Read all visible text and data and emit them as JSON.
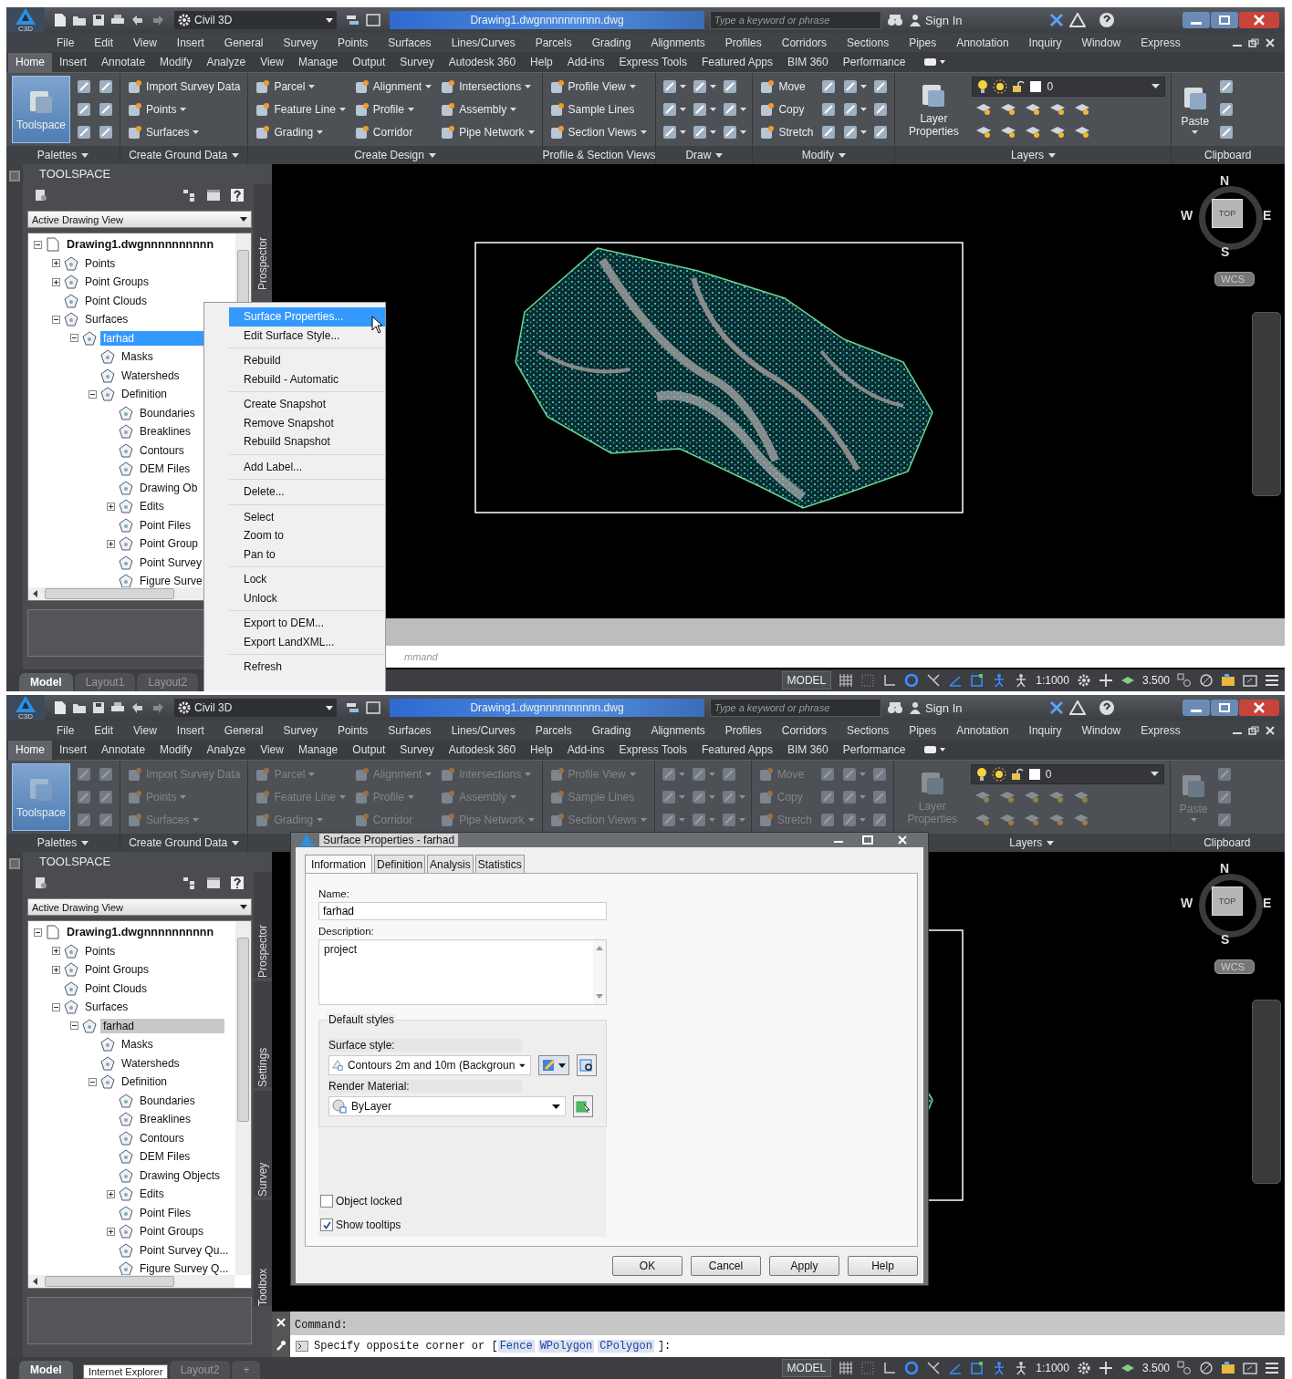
{
  "screens": [
    {
      "title_bar": {
        "app_badge": "C3D",
        "workspace": "Civil 3D",
        "document": "Drawing1.dwgnnnnnnnnnn.dwg",
        "placeholder": "Type a keyword or phrase",
        "sign_in": "Sign In"
      },
      "menu": [
        "File",
        "Edit",
        "View",
        "Insert",
        "General",
        "Survey",
        "Points",
        "Surfaces",
        "Lines/Curves",
        "Parcels",
        "Grading",
        "Alignments",
        "Profiles",
        "Corridors",
        "Sections",
        "Pipes",
        "Annotation",
        "Inquiry",
        "Window",
        "Express"
      ],
      "ribbon_tabs": [
        {
          "label": "Home",
          "selected": true
        },
        {
          "label": "Insert",
          "selected": false
        },
        {
          "label": "Annotate",
          "selected": false
        },
        {
          "label": "Modify",
          "selected": false
        },
        {
          "label": "Analyze",
          "selected": false
        },
        {
          "label": "View",
          "selected": false
        },
        {
          "label": "Manage",
          "selected": false
        },
        {
          "label": "Output",
          "selected": false
        },
        {
          "label": "Survey",
          "selected": false
        },
        {
          "label": "Autodesk 360",
          "selected": false
        },
        {
          "label": "Help",
          "selected": false
        },
        {
          "label": "Add-ins",
          "selected": false
        },
        {
          "label": "Express Tools",
          "selected": false
        },
        {
          "label": "Featured Apps",
          "selected": false
        },
        {
          "label": "BIM 360",
          "selected": false
        },
        {
          "label": "Performance",
          "selected": false
        }
      ],
      "ribbon": {
        "disabled": false,
        "panels": [
          {
            "title": "Palettes",
            "menu": true,
            "columns": [
              [
                {
                  "kind": "large",
                  "label": "Toolspace",
                  "on": true,
                  "menu": false
                }
              ],
              [
                {
                  "kind": "icon",
                  "menu": false
                },
                {
                  "kind": "icon",
                  "menu": false
                },
                {
                  "kind": "icon",
                  "menu": false
                }
              ],
              [
                {
                  "kind": "icon",
                  "menu": false
                },
                {
                  "kind": "icon",
                  "menu": false
                },
                {
                  "kind": "icon",
                  "menu": false
                }
              ]
            ]
          },
          {
            "title": "Create Ground Data",
            "menu": true,
            "columns": [
              [
                {
                  "kind": "small",
                  "label": "Import Survey Data",
                  "menu": false
                },
                {
                  "kind": "small",
                  "label": "Points",
                  "menu": true
                },
                {
                  "kind": "small",
                  "label": "Surfaces",
                  "menu": true
                }
              ]
            ]
          },
          {
            "title": "Create Design",
            "menu": true,
            "columns": [
              [
                {
                  "kind": "small",
                  "label": "Parcel",
                  "menu": true
                },
                {
                  "kind": "small",
                  "label": "Feature Line",
                  "menu": true
                },
                {
                  "kind": "small",
                  "label": "Grading",
                  "menu": true
                }
              ],
              [
                {
                  "kind": "small",
                  "label": "Alignment",
                  "menu": true
                },
                {
                  "kind": "small",
                  "label": "Profile",
                  "menu": true
                },
                {
                  "kind": "small",
                  "label": "Corridor",
                  "menu": false
                }
              ],
              [
                {
                  "kind": "small",
                  "label": "Intersections",
                  "menu": true
                },
                {
                  "kind": "small",
                  "label": "Assembly",
                  "menu": true
                },
                {
                  "kind": "small",
                  "label": "Pipe Network",
                  "menu": true
                }
              ]
            ]
          },
          {
            "title": "Profile & Section Views",
            "menu": false,
            "columns": [
              [
                {
                  "kind": "small",
                  "label": "Profile View",
                  "menu": true
                },
                {
                  "kind": "small",
                  "label": "Sample Lines",
                  "menu": false
                },
                {
                  "kind": "small",
                  "label": "Section Views",
                  "menu": true
                }
              ]
            ]
          },
          {
            "title": "Draw",
            "menu": true,
            "columns": [
              [
                {
                  "kind": "icon",
                  "menu": true
                },
                {
                  "kind": "icon",
                  "menu": true
                },
                {
                  "kind": "icon",
                  "menu": true
                }
              ],
              [
                {
                  "kind": "icon",
                  "menu": true
                },
                {
                  "kind": "icon",
                  "menu": true
                },
                {
                  "kind": "icon",
                  "menu": true
                }
              ],
              [
                {
                  "kind": "icon",
                  "menu": false
                },
                {
                  "kind": "icon",
                  "menu": true
                },
                {
                  "kind": "icon",
                  "menu": true
                }
              ]
            ]
          },
          {
            "title": "Modify",
            "menu": true,
            "columns": [
              [
                {
                  "kind": "small",
                  "label": "Move",
                  "menu": false
                },
                {
                  "kind": "small",
                  "label": "Copy",
                  "menu": false
                },
                {
                  "kind": "small",
                  "label": "Stretch",
                  "menu": false
                }
              ],
              [
                {
                  "kind": "icon",
                  "menu": false
                },
                {
                  "kind": "icon",
                  "menu": false
                },
                {
                  "kind": "icon",
                  "menu": false
                }
              ],
              [
                {
                  "kind": "icon",
                  "menu": true
                },
                {
                  "kind": "icon",
                  "menu": true
                },
                {
                  "kind": "icon",
                  "menu": true
                }
              ],
              [
                {
                  "kind": "icon",
                  "menu": false
                },
                {
                  "kind": "icon",
                  "menu": false
                },
                {
                  "kind": "icon",
                  "menu": false
                }
              ]
            ]
          },
          {
            "title": "Layers",
            "menu": true,
            "columns": [
              [
                {
                  "kind": "large",
                  "label": "Layer Properties",
                  "on": false,
                  "menu": false
                }
              ],
              [
                {
                  "kind": "combo",
                  "label": "0",
                  "menu": true
                },
                {
                  "kind": "strip",
                  "menu": false
                },
                {
                  "kind": "strip",
                  "menu": false
                }
              ]
            ]
          },
          {
            "title": "Clipboard",
            "menu": false,
            "columns": [
              [
                {
                  "kind": "large",
                  "label": "Paste",
                  "on": false,
                  "menu": true
                }
              ],
              [
                {
                  "kind": "icon",
                  "menu": false
                },
                {
                  "kind": "icon",
                  "menu": false
                },
                {
                  "kind": "icon",
                  "menu": false
                }
              ]
            ]
          }
        ]
      },
      "toolspace": {
        "title": "TOOLSPACE",
        "view": "Active Drawing View",
        "tree_focused": true,
        "side_tabs": [
          "Prospector"
        ],
        "tree": {
          "label": "Drawing1.dwgnnnnnnnnnn",
          "expanded": true,
          "selected": false,
          "children": [
            {
              "label": "Points",
              "expanded": false,
              "selected": false
            },
            {
              "label": "Point Groups",
              "expanded": false,
              "selected": false
            },
            {
              "label": "Point Clouds",
              "selected": false
            },
            {
              "label": "Surfaces",
              "expanded": true,
              "selected": false,
              "children": [
                {
                  "label": "farhad",
                  "expanded": true,
                  "selected": true,
                  "children": [
                    {
                      "label": "Masks",
                      "selected": false
                    },
                    {
                      "label": "Watersheds",
                      "selected": false
                    },
                    {
                      "label": "Definition",
                      "expanded": true,
                      "selected": false,
                      "children": [
                        {
                          "label": "Boundaries",
                          "selected": false
                        },
                        {
                          "label": "Breaklines",
                          "selected": false
                        },
                        {
                          "label": "Contours",
                          "selected": false
                        },
                        {
                          "label": "DEM Files",
                          "selected": false
                        },
                        {
                          "label": "Drawing Ob",
                          "selected": false
                        },
                        {
                          "label": "Edits",
                          "expanded": false,
                          "selected": false
                        },
                        {
                          "label": "Point Files",
                          "selected": false
                        },
                        {
                          "label": "Point Group",
                          "expanded": false,
                          "selected": false
                        },
                        {
                          "label": "Point Survey",
                          "selected": false
                        },
                        {
                          "label": "Figure Surve",
                          "selected": false
                        }
                      ]
                    }
                  ]
                }
              ]
            }
          ]
        }
      },
      "viewport": {
        "north": "N",
        "south": "S",
        "east": "E",
        "west": "W",
        "top": "TOP",
        "ucs": "WCS"
      },
      "layout_tabs": [
        {
          "label": "Model",
          "selected": true
        },
        {
          "label": "Layout1",
          "selected": false
        },
        {
          "label": "Layout2",
          "selected": false
        }
      ],
      "command": {
        "placeholder": "mmand"
      },
      "status_bar": {
        "model": "MODEL",
        "scale": "1:1000",
        "annotation_scale": "3.500"
      },
      "context_menu": {
        "groups": [
          {
            "items": [
              {
                "label": "Surface Properties...",
                "selected": true
              },
              {
                "label": "Edit Surface Style...",
                "selected": false
              }
            ]
          },
          {
            "items": [
              {
                "label": "Rebuild",
                "selected": false
              },
              {
                "label": "Rebuild - Automatic",
                "selected": false
              }
            ]
          },
          {
            "items": [
              {
                "label": "Create Snapshot",
                "selected": false
              },
              {
                "label": "Remove Snapshot",
                "selected": false
              },
              {
                "label": "Rebuild Snapshot",
                "selected": false
              }
            ]
          },
          {
            "items": [
              {
                "label": "Add Label...",
                "selected": false
              }
            ]
          },
          {
            "items": [
              {
                "label": "Delete...",
                "selected": false
              }
            ]
          },
          {
            "items": [
              {
                "label": "Select",
                "selected": false
              },
              {
                "label": "Zoom to",
                "selected": false
              },
              {
                "label": "Pan to",
                "selected": false
              }
            ]
          },
          {
            "items": [
              {
                "label": "Lock",
                "selected": false
              },
              {
                "label": "Unlock",
                "selected": false
              }
            ]
          },
          {
            "items": [
              {
                "label": "Export to DEM...",
                "selected": false
              },
              {
                "label": "Export LandXML...",
                "selected": false
              }
            ]
          },
          {
            "items": [
              {
                "label": "Refresh",
                "selected": false
              }
            ]
          }
        ]
      }
    },
    {
      "title_bar": {
        "app_badge": "C3D",
        "workspace": "Civil 3D",
        "document": "Drawing1.dwgnnnnnnnnnn.dwg",
        "placeholder": "Type a keyword or phrase",
        "sign_in": "Sign In"
      },
      "menu": [
        "File",
        "Edit",
        "View",
        "Insert",
        "General",
        "Survey",
        "Points",
        "Surfaces",
        "Lines/Curves",
        "Parcels",
        "Grading",
        "Alignments",
        "Profiles",
        "Corridors",
        "Sections",
        "Pipes",
        "Annotation",
        "Inquiry",
        "Window",
        "Express"
      ],
      "ribbon_tabs": [
        {
          "label": "Home",
          "selected": true
        },
        {
          "label": "Insert",
          "selected": false
        },
        {
          "label": "Annotate",
          "selected": false
        },
        {
          "label": "Modify",
          "selected": false
        },
        {
          "label": "Analyze",
          "selected": false
        },
        {
          "label": "View",
          "selected": false
        },
        {
          "label": "Manage",
          "selected": false
        },
        {
          "label": "Output",
          "selected": false
        },
        {
          "label": "Survey",
          "selected": false
        },
        {
          "label": "Autodesk 360",
          "selected": false
        },
        {
          "label": "Help",
          "selected": false
        },
        {
          "label": "Add-ins",
          "selected": false
        },
        {
          "label": "Express Tools",
          "selected": false
        },
        {
          "label": "Featured Apps",
          "selected": false
        },
        {
          "label": "BIM 360",
          "selected": false
        },
        {
          "label": "Performance",
          "selected": false
        }
      ],
      "ribbon": {
        "disabled": true,
        "panels": [
          {
            "title": "Palettes",
            "menu": true,
            "columns": [
              [
                {
                  "kind": "large",
                  "label": "Toolspace",
                  "on": true,
                  "menu": false
                }
              ],
              [
                {
                  "kind": "icon",
                  "menu": false
                },
                {
                  "kind": "icon",
                  "menu": false
                },
                {
                  "kind": "icon",
                  "menu": false
                }
              ],
              [
                {
                  "kind": "icon",
                  "menu": false
                },
                {
                  "kind": "icon",
                  "menu": false
                },
                {
                  "kind": "icon",
                  "menu": false
                }
              ]
            ]
          },
          {
            "title": "Create Ground Data",
            "menu": true,
            "columns": [
              [
                {
                  "kind": "small",
                  "label": "Import Survey Data",
                  "menu": false
                },
                {
                  "kind": "small",
                  "label": "Points",
                  "menu": true
                },
                {
                  "kind": "small",
                  "label": "Surfaces",
                  "menu": true
                }
              ]
            ]
          },
          {
            "columns": [
              [
                {
                  "kind": "small",
                  "label": "Parcel",
                  "menu": true
                },
                {
                  "kind": "small",
                  "label": "Feature Line",
                  "menu": true
                },
                {
                  "kind": "small",
                  "label": "Grading",
                  "menu": true
                }
              ],
              [
                {
                  "kind": "small",
                  "label": "Alignment",
                  "menu": true
                },
                {
                  "kind": "small",
                  "label": "Profile",
                  "menu": true
                },
                {
                  "kind": "small",
                  "label": "Corridor",
                  "menu": false
                }
              ],
              [
                {
                  "kind": "small",
                  "label": "Intersections",
                  "menu": true
                },
                {
                  "kind": "small",
                  "label": "Assembly",
                  "menu": true
                },
                {
                  "kind": "small",
                  "label": "Pipe Network",
                  "menu": true
                }
              ]
            ]
          },
          {
            "columns": [
              [
                {
                  "kind": "small",
                  "label": "Profile View",
                  "menu": true
                },
                {
                  "kind": "small",
                  "label": "Sample Lines",
                  "menu": false
                },
                {
                  "kind": "small",
                  "label": "Section Views",
                  "menu": true
                }
              ]
            ]
          },
          {
            "columns": [
              [
                {
                  "kind": "icon",
                  "menu": true
                },
                {
                  "kind": "icon",
                  "menu": true
                },
                {
                  "kind": "icon",
                  "menu": true
                }
              ],
              [
                {
                  "kind": "icon",
                  "menu": true
                },
                {
                  "kind": "icon",
                  "menu": true
                },
                {
                  "kind": "icon",
                  "menu": true
                }
              ],
              [
                {
                  "kind": "icon",
                  "menu": false
                },
                {
                  "kind": "icon",
                  "menu": true
                },
                {
                  "kind": "icon",
                  "menu": true
                }
              ]
            ]
          },
          {
            "columns": [
              [
                {
                  "kind": "small",
                  "label": "Move",
                  "menu": false
                },
                {
                  "kind": "small",
                  "label": "Copy",
                  "menu": false
                },
                {
                  "kind": "small",
                  "label": "Stretch",
                  "menu": false
                }
              ],
              [
                {
                  "kind": "icon",
                  "menu": false
                },
                {
                  "kind": "icon",
                  "menu": false
                },
                {
                  "kind": "icon",
                  "menu": false
                }
              ],
              [
                {
                  "kind": "icon",
                  "menu": true
                },
                {
                  "kind": "icon",
                  "menu": true
                },
                {
                  "kind": "icon",
                  "menu": true
                }
              ],
              [
                {
                  "kind": "icon",
                  "menu": false
                },
                {
                  "kind": "icon",
                  "menu": false
                },
                {
                  "kind": "icon",
                  "menu": false
                }
              ]
            ]
          },
          {
            "title": "Layers",
            "menu": true,
            "columns": [
              [
                {
                  "kind": "large",
                  "label": "Layer Properties",
                  "on": false,
                  "menu": false
                }
              ],
              [
                {
                  "kind": "combo",
                  "label": "0",
                  "menu": true
                },
                {
                  "kind": "strip",
                  "menu": false
                },
                {
                  "kind": "strip",
                  "menu": false
                }
              ]
            ]
          },
          {
            "title": "Clipboard",
            "menu": false,
            "columns": [
              [
                {
                  "kind": "large",
                  "label": "Paste",
                  "on": false,
                  "menu": true
                }
              ],
              [
                {
                  "kind": "icon",
                  "menu": false
                },
                {
                  "kind": "icon",
                  "menu": false
                },
                {
                  "kind": "icon",
                  "menu": false
                }
              ]
            ]
          }
        ]
      },
      "toolspace": {
        "title": "TOOLSPACE",
        "view": "Active Drawing View",
        "tree_focused": false,
        "side_tabs": [
          "Prospector",
          "Settings",
          "Survey",
          "Toolbox"
        ],
        "tree": {
          "label": "Drawing1.dwgnnnnnnnnnn",
          "expanded": true,
          "selected": false,
          "children": [
            {
              "label": "Points",
              "expanded": false,
              "selected": false
            },
            {
              "label": "Point Groups",
              "expanded": false,
              "selected": false
            },
            {
              "label": "Point Clouds",
              "selected": false
            },
            {
              "label": "Surfaces",
              "expanded": true,
              "selected": false,
              "children": [
                {
                  "label": "farhad",
                  "expanded": true,
                  "selected": true,
                  "children": [
                    {
                      "label": "Masks",
                      "selected": false
                    },
                    {
                      "label": "Watersheds",
                      "selected": false
                    },
                    {
                      "label": "Definition",
                      "expanded": true,
                      "selected": false,
                      "children": [
                        {
                          "label": "Boundaries",
                          "selected": false
                        },
                        {
                          "label": "Breaklines",
                          "selected": false
                        },
                        {
                          "label": "Contours",
                          "selected": false
                        },
                        {
                          "label": "DEM Files",
                          "selected": false
                        },
                        {
                          "label": "Drawing Objects",
                          "selected": false
                        },
                        {
                          "label": "Edits",
                          "expanded": false,
                          "selected": false
                        },
                        {
                          "label": "Point Files",
                          "selected": false
                        },
                        {
                          "label": "Point Groups",
                          "expanded": false,
                          "selected": false
                        },
                        {
                          "label": "Point Survey Qu...",
                          "selected": false
                        },
                        {
                          "label": "Figure Survey Q...",
                          "selected": false
                        }
                      ]
                    }
                  ]
                }
              ]
            }
          ]
        }
      },
      "viewport": {
        "north": "N",
        "south": "S",
        "east": "E",
        "west": "W",
        "top": "TOP",
        "ucs": "WCS"
      },
      "layout_tabs": [
        {
          "label": "Model",
          "selected": true
        },
        {
          "label": "Layout2",
          "selected": false
        },
        {
          "label": "+",
          "selected": false
        }
      ],
      "command": {
        "history": "Command:",
        "prompt": "Specify opposite corner or [",
        "options": [
          "Fence",
          "WPolygon",
          "CPolygon"
        ],
        "prompt_end": "]:"
      },
      "status_bar": {
        "model": "MODEL",
        "scale": "1:1000",
        "annotation_scale": "3.500"
      },
      "tooltip": "Internet Explorer",
      "dialog": {
        "title": "Surface Properties - farhad",
        "tabs": [
          {
            "label": "Information",
            "selected": true
          },
          {
            "label": "Definition",
            "selected": false
          },
          {
            "label": "Analysis",
            "selected": false
          },
          {
            "label": "Statistics",
            "selected": false
          }
        ],
        "name": {
          "label": "Name:",
          "value": "farhad"
        },
        "description": {
          "label": "Description:",
          "value": "project"
        },
        "styles": {
          "title": "Default styles",
          "surface_style": {
            "label": "Surface style:",
            "value": "Contours 2m and 10m (Backgroun"
          },
          "render_material": {
            "label": "Render Material:",
            "value": "ByLayer"
          }
        },
        "checkboxes": [
          {
            "label": "Object locked",
            "checked": false
          },
          {
            "label": "Show tooltips",
            "checked": true
          }
        ],
        "buttons": [
          "OK",
          "Cancel",
          "Apply",
          "Help"
        ]
      }
    }
  ]
}
